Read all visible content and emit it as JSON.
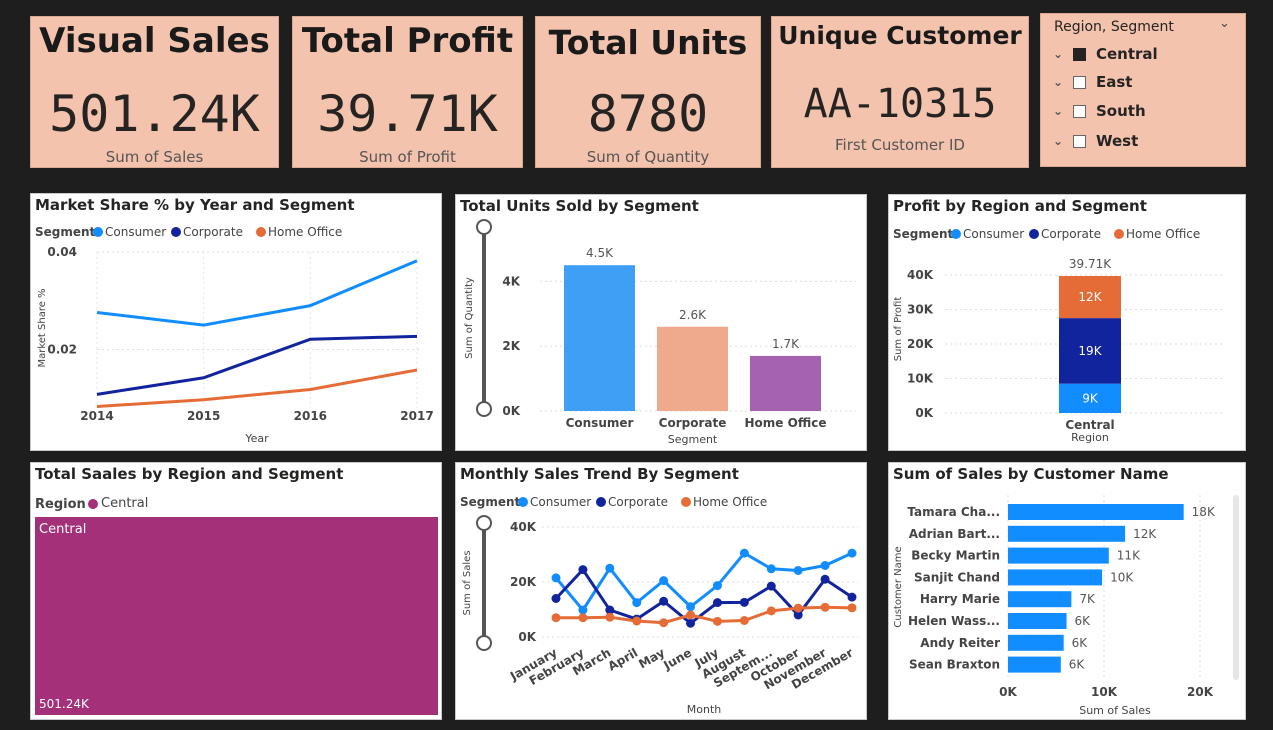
{
  "kpis": [
    {
      "title": "Visual Sales",
      "value": "501.24K",
      "sub": "Sum of Sales"
    },
    {
      "title": "Total Profit",
      "value": "39.71K",
      "sub": "Sum of Profit"
    },
    {
      "title": "Total Units",
      "value": "8780",
      "sub": "Sum of Quantity"
    },
    {
      "title": "Unique Customer",
      "value": "AA-10315",
      "sub": "First Customer ID"
    }
  ],
  "slicer": {
    "title": "Region, Segment",
    "items": [
      {
        "label": "Central",
        "checked": true
      },
      {
        "label": "East",
        "checked": false
      },
      {
        "label": "South",
        "checked": false
      },
      {
        "label": "West",
        "checked": false
      }
    ]
  },
  "legend_segment": {
    "label": "Segment",
    "items": [
      "Consumer",
      "Corporate",
      "Home Office"
    ]
  },
  "colors": {
    "consumer": "#118dff",
    "corporate": "#12239e",
    "home_office": "#e66c37",
    "kpi_bg": "#f4c3ad",
    "treemap": "#a4307a"
  },
  "panels": {
    "market_share": {
      "title": "Market Share % by Year and Segment"
    },
    "units": {
      "title": "Total Units Sold by Segment"
    },
    "profit": {
      "title": "Profit by Region and Segment"
    },
    "treemap": {
      "title": "Total Saales by Region and Segment",
      "legend_label": "Region",
      "legend_item": "Central",
      "tile_label": "Central",
      "tile_value": "501.24K"
    },
    "monthly": {
      "title": "Monthly Sales Trend By Segment"
    },
    "customers": {
      "title": "Sum of Sales by Customer Name"
    }
  },
  "chart_data": [
    {
      "id": "market_share",
      "type": "line",
      "title": "Market Share % by Year and Segment",
      "x": [
        "2014",
        "2015",
        "2016",
        "2017"
      ],
      "xlabel": "Year",
      "ylabel": "Market Share %",
      "ylim": [
        0.008,
        0.04
      ],
      "yticks": [
        "0.02",
        "0.04"
      ],
      "series": [
        {
          "name": "Consumer",
          "values": [
            0.0276,
            0.025,
            0.029,
            0.0382
          ]
        },
        {
          "name": "Corporate",
          "values": [
            0.0108,
            0.0142,
            0.0221,
            0.0227
          ]
        },
        {
          "name": "Home Office",
          "values": [
            0.0083,
            0.0097,
            0.0118,
            0.0158
          ]
        }
      ]
    },
    {
      "id": "units",
      "type": "bar",
      "title": "Total Units Sold by Segment",
      "categories": [
        "Consumer",
        "Corporate",
        "Home Office"
      ],
      "values": [
        4500,
        2600,
        1700
      ],
      "data_labels": [
        "4.5K",
        "2.6K",
        "1.7K"
      ],
      "xlabel": "Segment",
      "ylabel": "Sum of Quantity",
      "ylim": [
        0,
        5000
      ],
      "yticks": [
        "0K",
        "2K",
        "4K"
      ]
    },
    {
      "id": "profit",
      "type": "bar",
      "title": "Profit by Region and Segment",
      "stacked": true,
      "categories": [
        "Central"
      ],
      "xlabel": "Region",
      "ylabel": "Sum of Profit",
      "ylim": [
        0,
        40000
      ],
      "yticks": [
        "0K",
        "10K",
        "20K",
        "30K",
        "40K"
      ],
      "total_label": "39.71K",
      "series": [
        {
          "name": "Consumer",
          "values": [
            8500
          ],
          "label": "9K"
        },
        {
          "name": "Corporate",
          "values": [
            19000
          ],
          "label": "19K"
        },
        {
          "name": "Home Office",
          "values": [
            12210
          ],
          "label": "12K"
        }
      ]
    },
    {
      "id": "treemap",
      "type": "heatmap",
      "title": "Total Saales by Region and Segment",
      "categories": [
        "Central"
      ],
      "values": [
        501240
      ]
    },
    {
      "id": "monthly",
      "type": "line",
      "title": "Monthly Sales Trend By Segment",
      "x": [
        "January",
        "February",
        "March",
        "April",
        "May",
        "June",
        "July",
        "August",
        "Septem...",
        "October",
        "November",
        "December"
      ],
      "xlabel": "Month",
      "ylabel": "Sum of Sales",
      "ylim": [
        0,
        40000
      ],
      "yticks": [
        "0K",
        "20K",
        "40K"
      ],
      "series": [
        {
          "name": "Consumer",
          "values": [
            21500,
            9800,
            25000,
            12500,
            20500,
            11000,
            18700,
            30500,
            24800,
            24200,
            26000,
            30500
          ]
        },
        {
          "name": "Corporate",
          "values": [
            14000,
            24500,
            9800,
            6500,
            13000,
            5000,
            12500,
            12600,
            18500,
            8000,
            21000,
            14500
          ]
        },
        {
          "name": "Home Office",
          "values": [
            7000,
            7000,
            7200,
            5800,
            5200,
            8000,
            5700,
            6000,
            9500,
            10500,
            10800,
            10600
          ]
        }
      ]
    },
    {
      "id": "customers",
      "type": "bar",
      "orientation": "horizontal",
      "title": "Sum of Sales by Customer Name",
      "categories": [
        "Tamara Cha...",
        "Adrian Bart...",
        "Becky Martin",
        "Sanjit Chand",
        "Harry Marie",
        "Helen Wass...",
        "Andy Reiter",
        "Sean Braxton"
      ],
      "values": [
        18300,
        12200,
        10500,
        9800,
        6600,
        6100,
        5800,
        5500
      ],
      "data_labels": [
        "18K",
        "12K",
        "11K",
        "10K",
        "7K",
        "6K",
        "6K",
        "6K"
      ],
      "xlabel": "Sum of Sales",
      "ylabel": "Customer Name",
      "xlim": [
        0,
        20000
      ],
      "xticks": [
        "0K",
        "10K",
        "20K"
      ]
    }
  ]
}
